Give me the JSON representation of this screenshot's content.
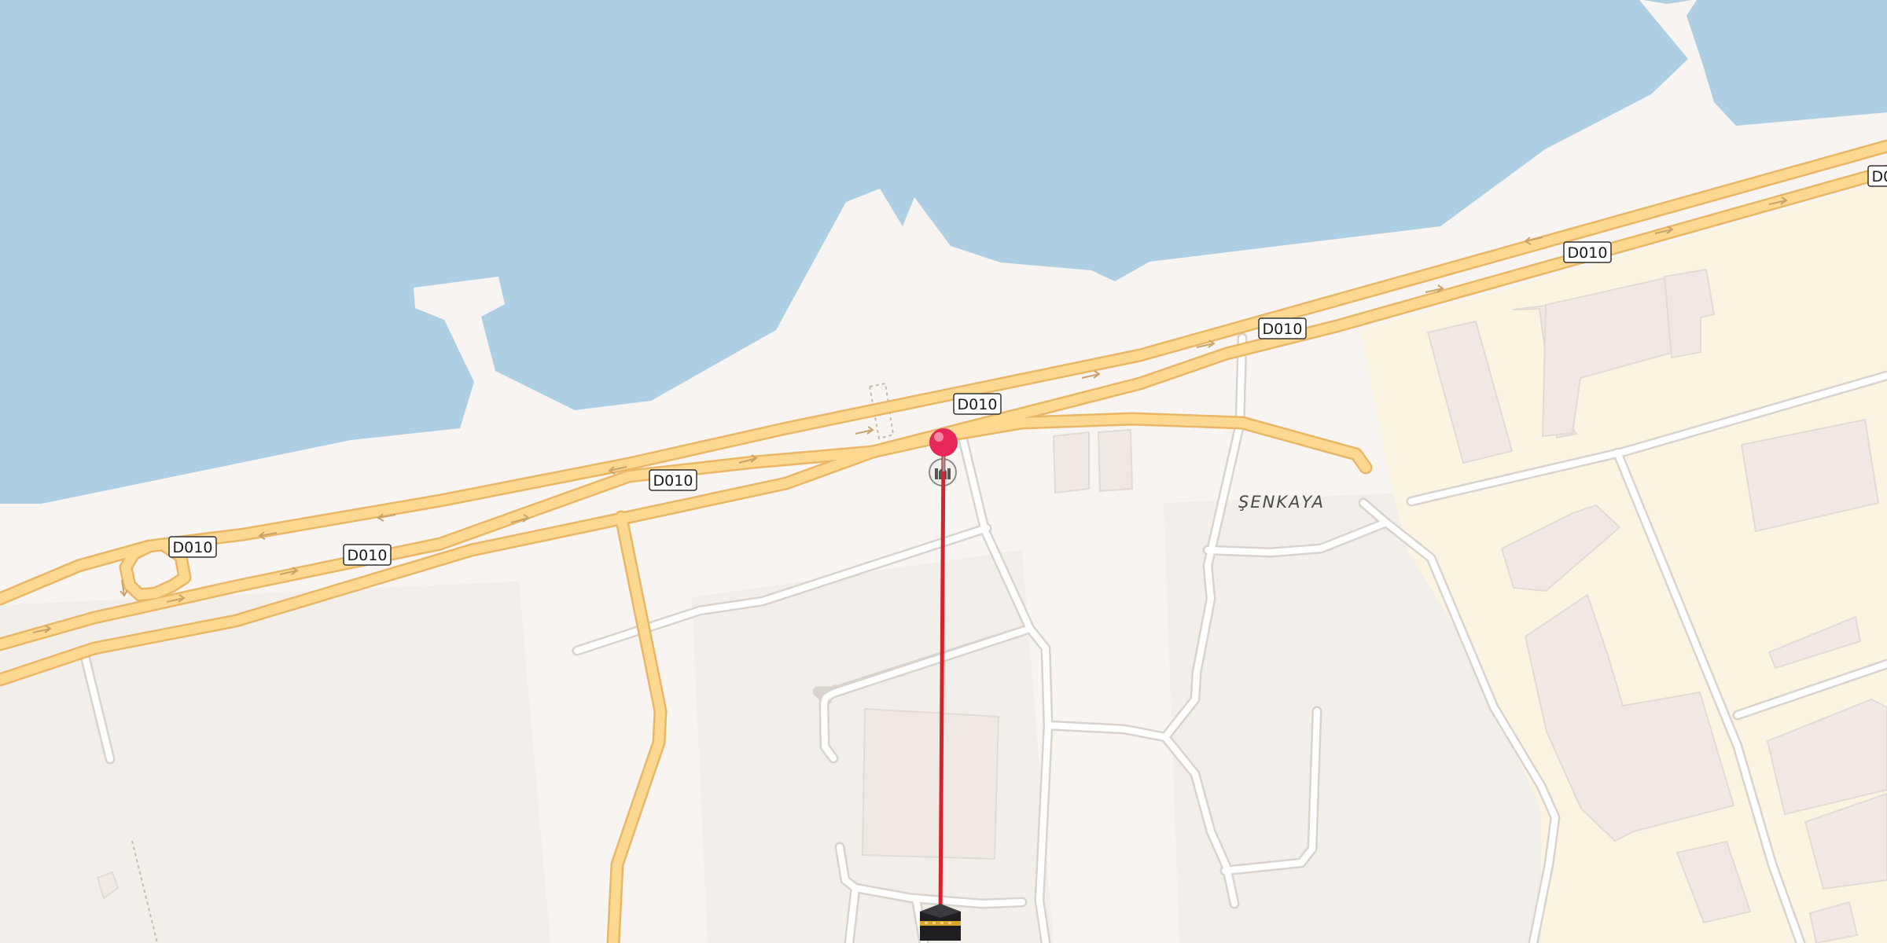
{
  "map": {
    "place_label": "ŞENKAYA",
    "road_ref": "D010",
    "colors": {
      "water": "#aecfe3",
      "land": "#f7f4f1",
      "land_shade": "#f1ece8",
      "industrial": "#fbf4e1",
      "building": "#efe8e3",
      "building_edge": "#e2dad4",
      "trunk_road": "#fcd891",
      "trunk_casing": "#eab767",
      "minor_road": "#ffffff",
      "minor_casing": "#d9d3cd",
      "qibla_line": "#d7242c",
      "pin": "#e8265a"
    },
    "markers": {
      "location_pin": "location-pin-icon",
      "mosque": "mosque-icon",
      "kaaba": "kaaba-icon"
    }
  }
}
